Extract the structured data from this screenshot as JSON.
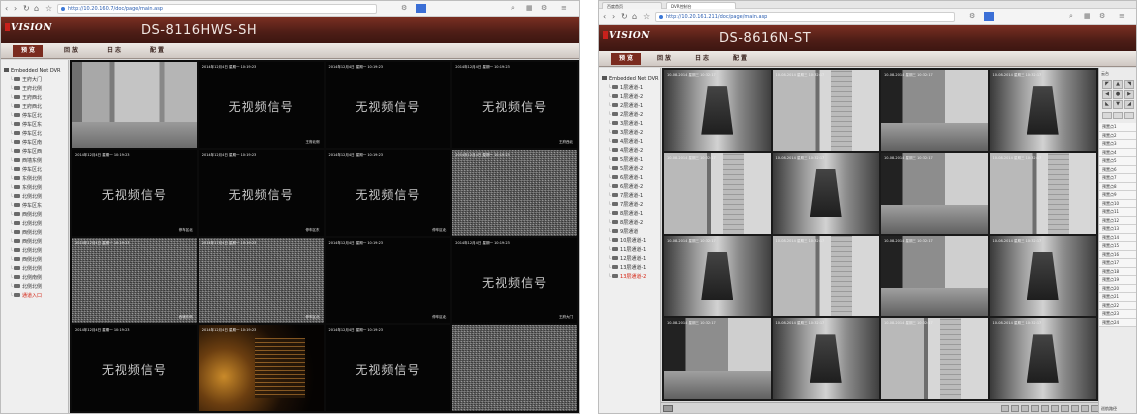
{
  "left": {
    "url": "http://10.20.160.7/doc/page/main.asp",
    "logo": "VISION",
    "model": "DS-8116HWS-SH",
    "menu": [
      "预 览",
      "回 放",
      "日 志",
      "配 置"
    ],
    "tree_root": "Embedded Net DVR",
    "cameras": [
      "王府大门",
      "王府北侧",
      "王府西北",
      "王府西北",
      "停车区北",
      "停车区东",
      "停车区北",
      "停车区南",
      "停车区西",
      "西墙东侧",
      "停车区北",
      "东侧北侧",
      "东侧北侧",
      "北侧北侧",
      "停车区东",
      "西侧北侧",
      "北侧北侧",
      "西侧北侧",
      "西侧北侧",
      "北侧北侧",
      "西侧北侧",
      "北侧北侧",
      "北侧南侧",
      "北侧北侧",
      "通道入口"
    ],
    "selected_camera": "通道入口",
    "no_signal": "无视频信号",
    "tiles": [
      {
        "type": "door",
        "ts": "",
        "name": "王府大门"
      },
      {
        "type": "nosig",
        "ts": "2014年12月4日 星期一 10:19:23",
        "name": "王府北侧"
      },
      {
        "type": "nosig",
        "ts": "2014年12月4日 星期一 10:19:23",
        "name": ""
      },
      {
        "type": "nosig",
        "ts": "2014年12月4日 星期一 10:19:23",
        "name": "王府西北"
      },
      {
        "type": "nosig",
        "ts": "2014年12月4日 星期一 10:19:23",
        "name": "停车区北"
      },
      {
        "type": "nosig",
        "ts": "2014年12月4日 星期一 10:19:23",
        "name": "停车区东"
      },
      {
        "type": "nosig",
        "ts": "2014年12月4日 星期一 10:19:23",
        "name": "停车区北"
      },
      {
        "type": "static",
        "ts": "2014年12月4日 星期一 10:19:23",
        "name": ""
      },
      {
        "type": "static",
        "ts": "2014年12月4日 星期一 10:19:23",
        "name": "西墙东侧"
      },
      {
        "type": "static",
        "ts": "2014年12月4日 星期一 10:19:23",
        "name": "停车区北"
      },
      {
        "type": "black",
        "ts": "2014年12月4日 星期一 10:19:23",
        "name": "停车区北"
      },
      {
        "type": "nosig",
        "ts": "2014年12月4日 星期一 10:19:23",
        "name": "王府大门"
      },
      {
        "type": "nosig",
        "ts": "2014年12月4日 星期一 10:19:23",
        "name": ""
      },
      {
        "type": "night",
        "ts": "2014年12月4日 星期一 10:19:23",
        "name": ""
      },
      {
        "type": "nosig",
        "ts": "2014年12月4日 星期一 10:19:23",
        "name": ""
      },
      {
        "type": "static",
        "ts": "",
        "name": ""
      }
    ]
  },
  "right": {
    "tabs": [
      "百度首页",
      "DVR控制台"
    ],
    "url": "http://10.20.161.211/doc/page/main.asp",
    "logo": "VISION",
    "model": "DS-8616N-ST",
    "menu": [
      "预 览",
      "回 放",
      "日 志",
      "配 置"
    ],
    "tree_root": "Embedded Net DVR",
    "cameras": [
      "1层通道-1",
      "1层通道-2",
      "2层通道-1",
      "2层通道-2",
      "3层通道-1",
      "3层通道-2",
      "4层通道-1",
      "4层通道-2",
      "5层通道-1",
      "5层通道-2",
      "6层通道-1",
      "6层通道-2",
      "7层通道-1",
      "7层通道-2",
      "8层通道-1",
      "8层通道-2",
      "9层通道",
      "10层通道-1",
      "11层通道-1",
      "12层通道-1",
      "13层通道-1",
      "13层通道-2"
    ],
    "selected_camera": "13层通道-2",
    "tiles_ts": "10-08-2014 星期三 10:32:17",
    "tiles": [
      "corr",
      "corr2",
      "corr3",
      "corr",
      "corr2",
      "corr",
      "corr3",
      "corr2",
      "corr",
      "corr2",
      "corr3",
      "corr",
      "corr3",
      "corr",
      "corr2",
      "corr"
    ],
    "ptz_title": "云台",
    "presets": [
      "预置点1",
      "预置点2",
      "预置点3",
      "预置点4",
      "预置点5",
      "预置点6",
      "预置点7",
      "预置点8",
      "预置点9",
      "预置点10",
      "预置点11",
      "预置点12",
      "预置点13",
      "预置点14",
      "预置点15",
      "预置点16",
      "预置点17",
      "预置点18",
      "预置点19",
      "预置点20",
      "预置点21",
      "预置点22",
      "预置点23",
      "预置点24"
    ],
    "ptz_footer": "巡航路径"
  }
}
